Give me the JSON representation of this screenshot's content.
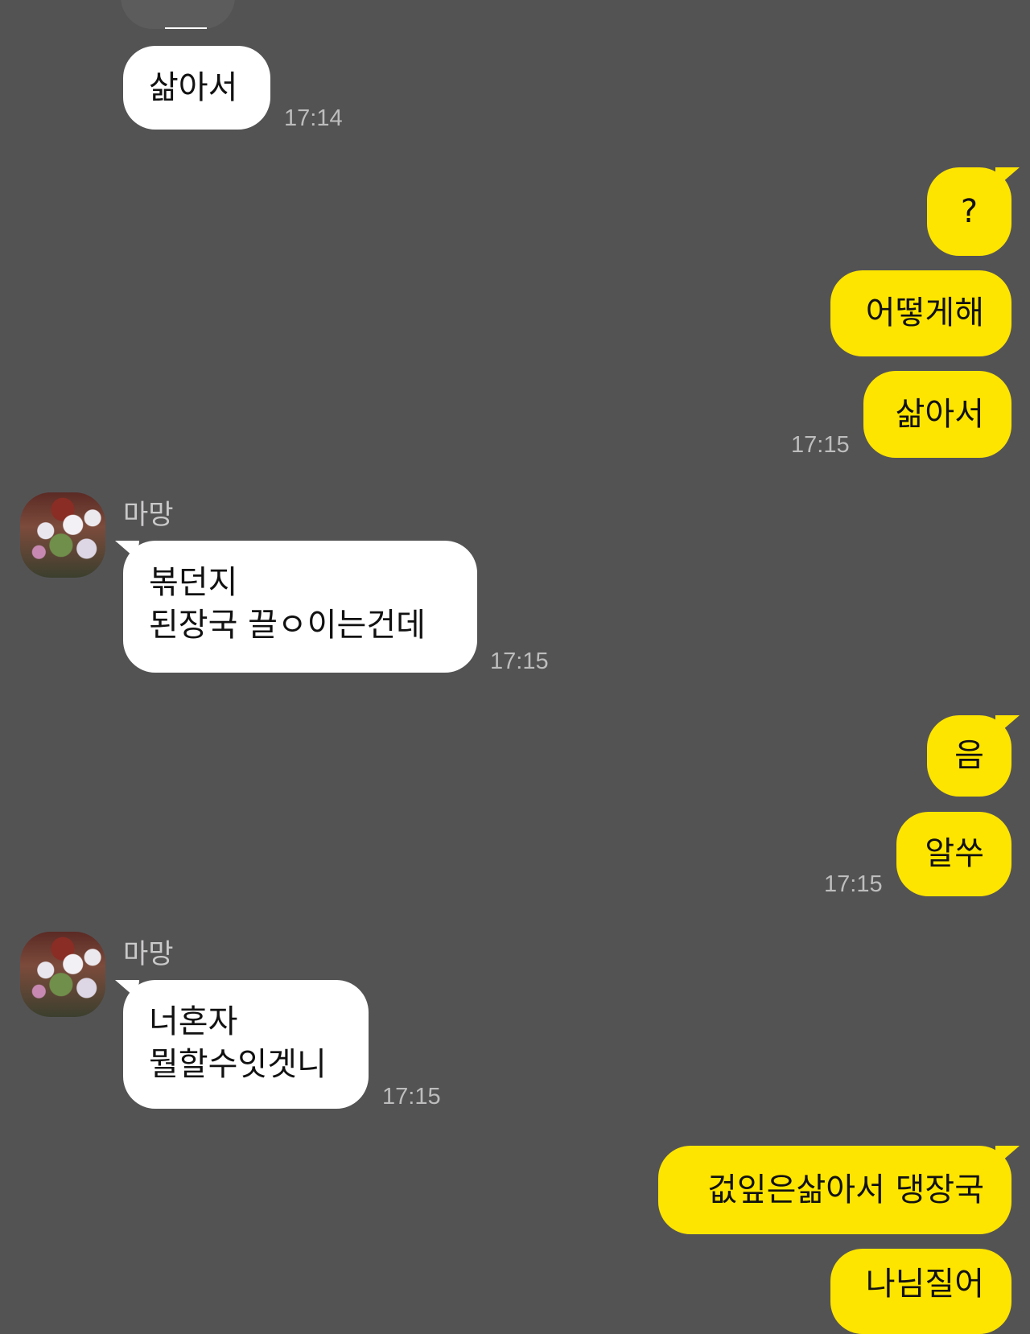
{
  "messages": [
    {
      "side": "in",
      "text": "삶아서",
      "time": "17:14"
    },
    {
      "side": "out",
      "text": "?"
    },
    {
      "side": "out",
      "text": "어떻게해"
    },
    {
      "side": "out",
      "text": "삶아서",
      "time": "17:15"
    },
    {
      "side": "in",
      "sender": "마망",
      "text": "볶던지\n된장국 끌ㅇ이는건데",
      "time": "17:15"
    },
    {
      "side": "out",
      "text": "음"
    },
    {
      "side": "out",
      "text": "알쑤",
      "time": "17:15"
    },
    {
      "side": "in",
      "sender": "마망",
      "text": "너혼자\n뭘할수잇겟니",
      "time": "17:15"
    },
    {
      "side": "out",
      "text": "겂잎은삶아서 댕장국"
    },
    {
      "side": "out",
      "text": "나님질어"
    }
  ],
  "colors": {
    "background": "#545354",
    "incoming_bubble": "#ffffff",
    "outgoing_bubble": "#fee500",
    "timestamp": "#bdbdbd"
  }
}
